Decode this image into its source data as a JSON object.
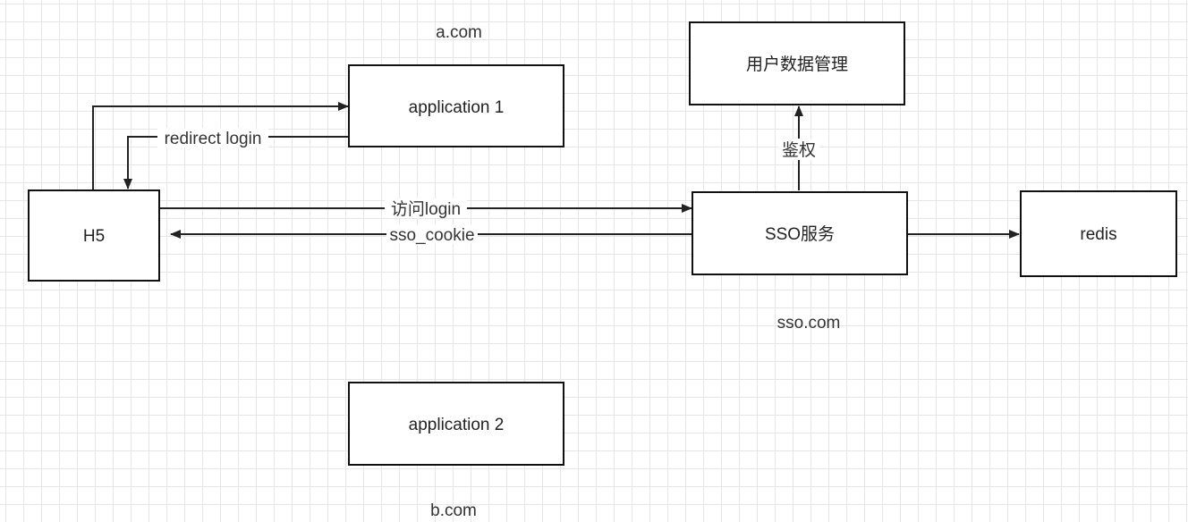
{
  "nodes": {
    "app1": "application 1",
    "app2": "application 2",
    "h5": "H5",
    "user_mgmt": "用户数据管理",
    "sso": "SSO服务",
    "redis": "redis"
  },
  "edges": {
    "redirect_login": "redirect login",
    "visit_login": "访问login",
    "sso_cookie": "sso_cookie",
    "auth": "鉴权"
  },
  "domains": {
    "a": "a.com",
    "b": "b.com",
    "sso": "sso.com"
  }
}
